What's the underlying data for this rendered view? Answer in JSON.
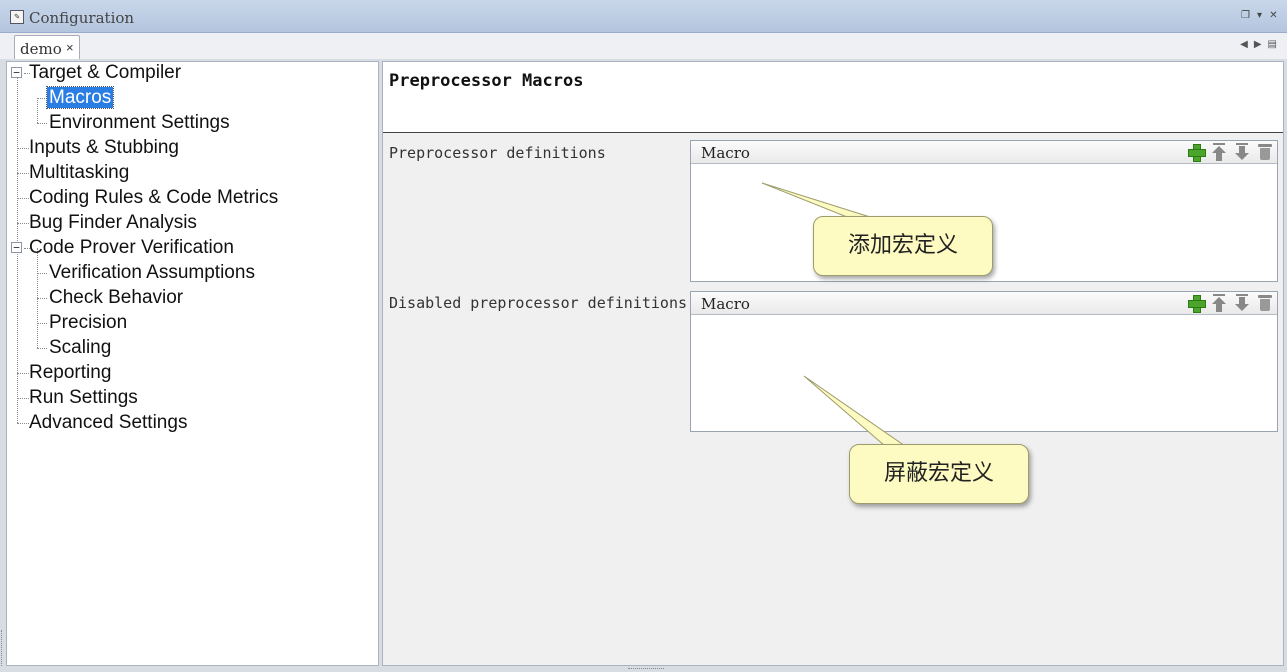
{
  "window": {
    "title": "Configuration",
    "title_icon": "configuration-icon",
    "controls": [
      "restore-icon",
      "maximize-icon",
      "close-icon"
    ]
  },
  "tabs": [
    {
      "label": "demo",
      "close": "×",
      "active": true
    }
  ],
  "tab_nav": {
    "prev": "◀",
    "next": "▶",
    "menu": "▤"
  },
  "tree": {
    "items": [
      {
        "label": "Target & Compiler",
        "level": 0,
        "expanded": true
      },
      {
        "label": "Macros",
        "level": 1,
        "selected": true
      },
      {
        "label": "Environment Settings",
        "level": 1
      },
      {
        "label": "Inputs & Stubbing",
        "level": 0
      },
      {
        "label": "Multitasking",
        "level": 0
      },
      {
        "label": "Coding Rules & Code Metrics",
        "level": 0
      },
      {
        "label": "Bug Finder Analysis",
        "level": 0
      },
      {
        "label": "Code Prover Verification",
        "level": 0,
        "expanded": true
      },
      {
        "label": "Verification Assumptions",
        "level": 1
      },
      {
        "label": "Check Behavior",
        "level": 1
      },
      {
        "label": "Precision",
        "level": 1
      },
      {
        "label": "Scaling",
        "level": 1
      },
      {
        "label": "Reporting",
        "level": 0
      },
      {
        "label": "Run Settings",
        "level": 0
      },
      {
        "label": "Advanced Settings",
        "level": 0
      }
    ]
  },
  "main": {
    "title": "Preprocessor Macros",
    "sections": [
      {
        "label": "Preprocessor definitions",
        "column": "Macro",
        "callout": "添加宏定义"
      },
      {
        "label": "Disabled preprocessor definitions",
        "column": "Macro",
        "callout": "屏蔽宏定义"
      }
    ],
    "table_icons": [
      "add-icon",
      "move-up-icon",
      "move-down-icon",
      "delete-icon"
    ]
  },
  "colors": {
    "selection": "#2a7ee3",
    "callout_fill": "#fdfbc2",
    "add_green": "#4aa52a"
  }
}
